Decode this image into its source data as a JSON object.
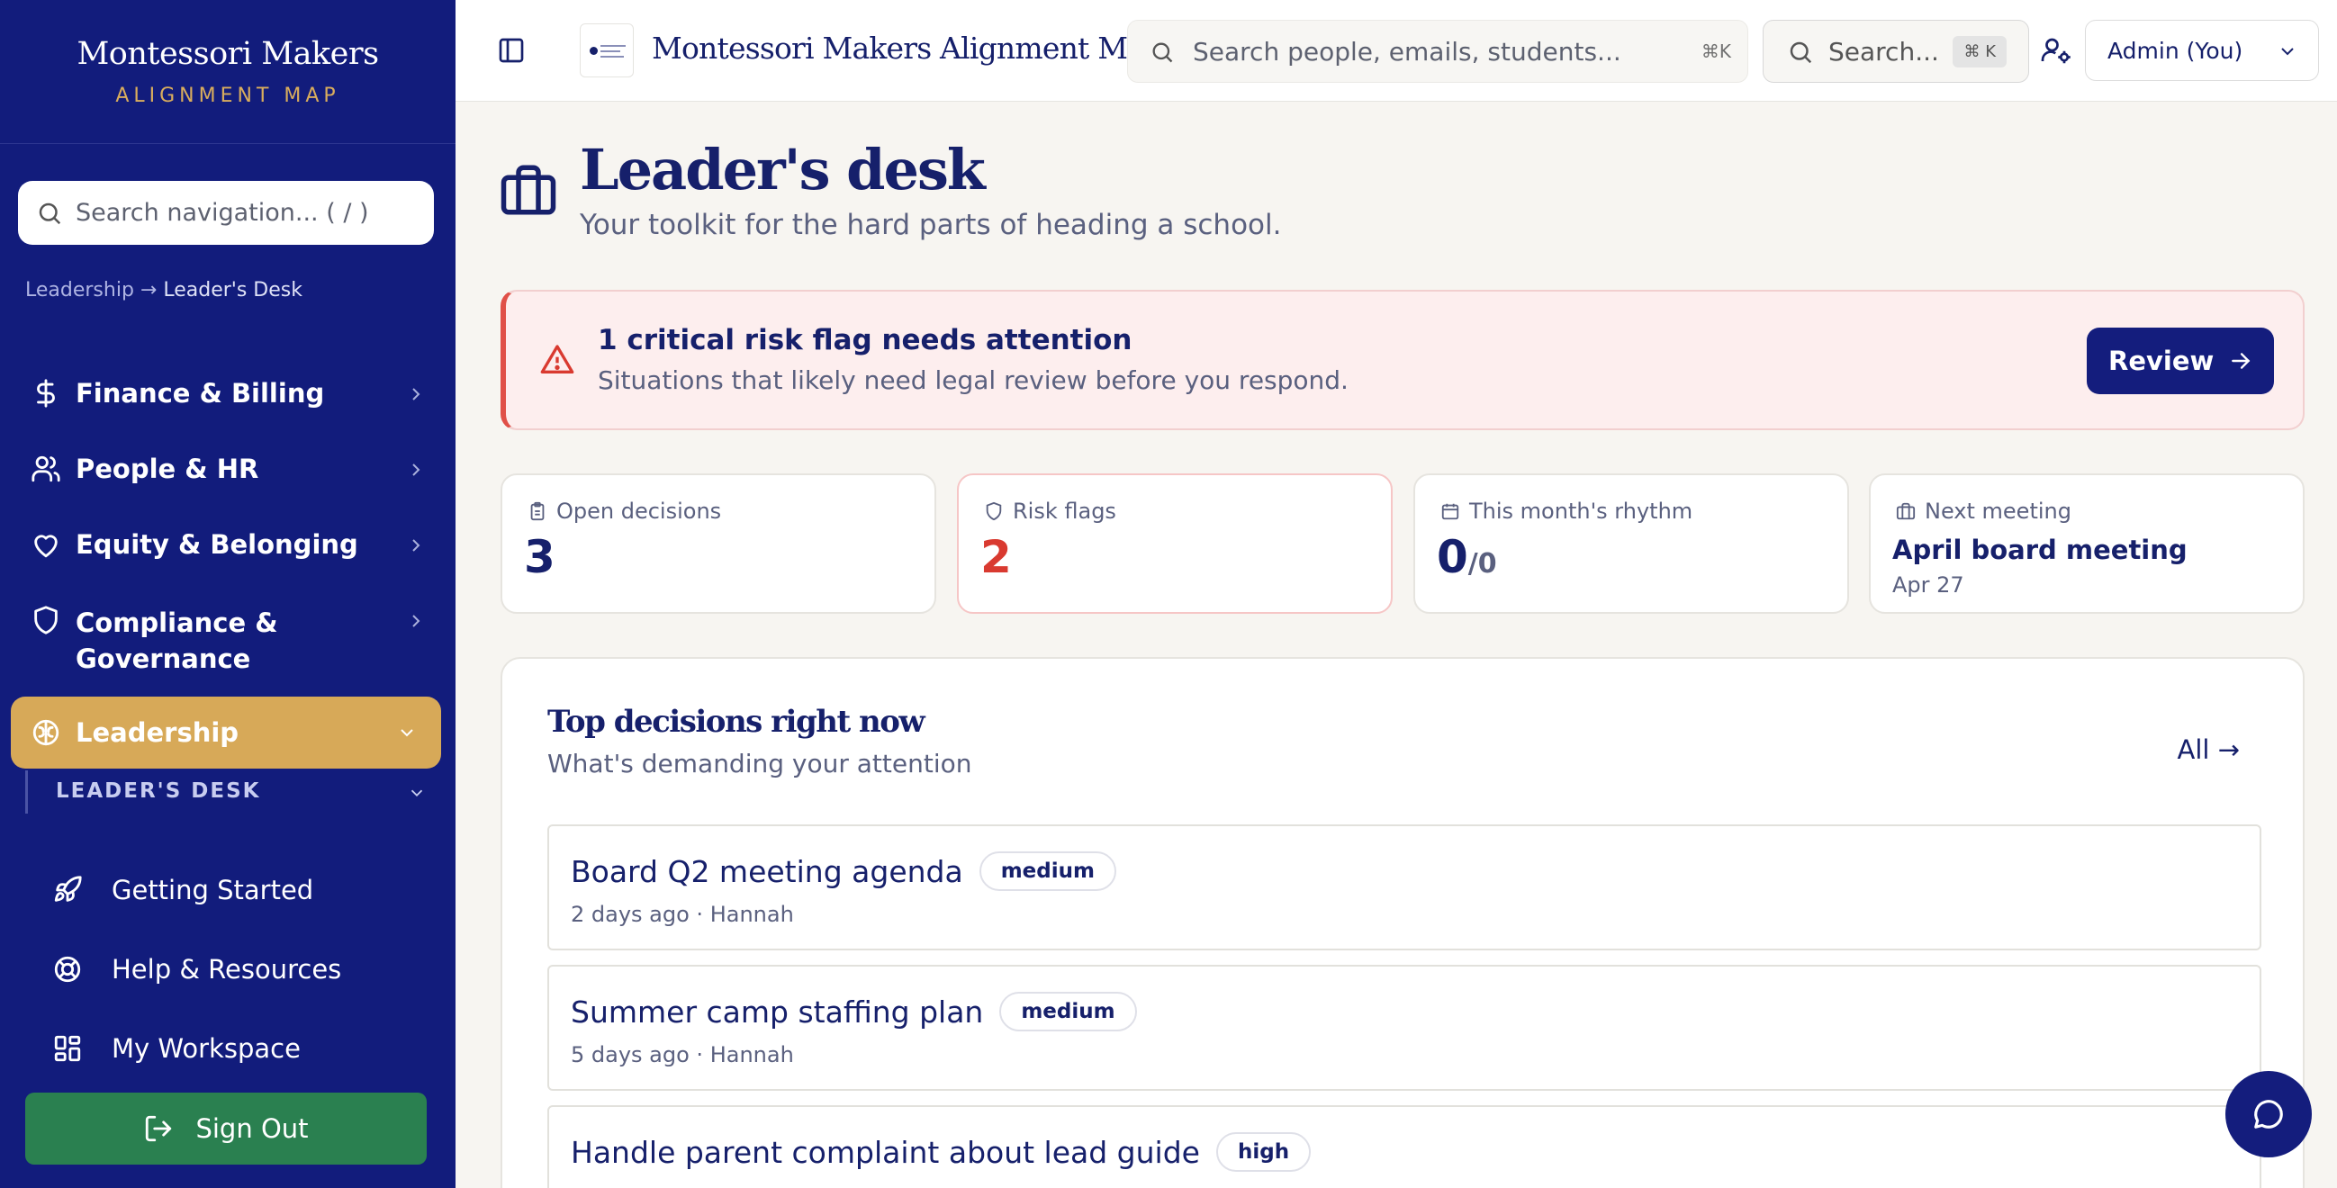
{
  "sidebar": {
    "brand_name": "Montessori Makers",
    "brand_sub": "ALIGNMENT MAP",
    "search_placeholder": "Search navigation... ( / )",
    "breadcrumb": {
      "parent": "Leadership",
      "sep": " → ",
      "current": "Leader's Desk"
    },
    "items": [
      {
        "label": "Finance & Billing",
        "icon": "dollar-icon"
      },
      {
        "label": "People & HR",
        "icon": "users-icon"
      },
      {
        "label": "Equity & Belonging",
        "icon": "heart-icon"
      },
      {
        "label": "Compliance &",
        "label2": "Governance",
        "icon": "shield-icon"
      }
    ],
    "active_item": {
      "label": "Leadership",
      "icon": "brain-icon"
    },
    "sub_section": "LEADER'S DESK",
    "utilities": [
      {
        "label": "Getting Started",
        "icon": "rocket-icon"
      },
      {
        "label": "Help & Resources",
        "icon": "lifebuoy-icon"
      },
      {
        "label": "My Workspace",
        "icon": "grid-icon"
      }
    ],
    "sign_out": "Sign Out"
  },
  "topbar": {
    "app_title": "Montessori Makers Alignment Map",
    "search_placeholder": "Search people, emails, students...",
    "search_kbd": "⌘K",
    "search2_label": "Search...",
    "search2_kbd": "⌘ K",
    "user_menu": "Admin (You)"
  },
  "page": {
    "title": "Leader's desk",
    "subtitle": "Your toolkit for the hard parts of heading a school."
  },
  "alert": {
    "title": "1 critical risk flag needs attention",
    "subtitle": "Situations that likely need legal review before you respond.",
    "button": "Review",
    "color": "#e05048"
  },
  "stats": {
    "open_decisions": {
      "label": "Open decisions",
      "value": "3"
    },
    "risk_flags": {
      "label": "Risk flags",
      "value": "2"
    },
    "rhythm": {
      "label": "This month's rhythm",
      "value": "0",
      "total": "/0"
    },
    "next_meeting": {
      "label": "Next meeting",
      "title": "April board meeting",
      "date": "Apr 27"
    }
  },
  "decisions": {
    "title": "Top decisions right now",
    "subtitle": "What's demanding your attention",
    "all_link": "All →",
    "items": [
      {
        "title": "Board Q2 meeting agenda",
        "priority": "medium",
        "meta": "2 days ago · Hannah"
      },
      {
        "title": "Summer camp staffing plan",
        "priority": "medium",
        "meta": "5 days ago · Hannah"
      },
      {
        "title": "Handle parent complaint about lead guide",
        "priority": "high",
        "meta": ""
      }
    ]
  },
  "colors": {
    "sidebar": "#121c7c",
    "accent_gold": "#d7a958",
    "navy": "#16206b",
    "danger": "#d93a30",
    "success": "#2a8050"
  }
}
